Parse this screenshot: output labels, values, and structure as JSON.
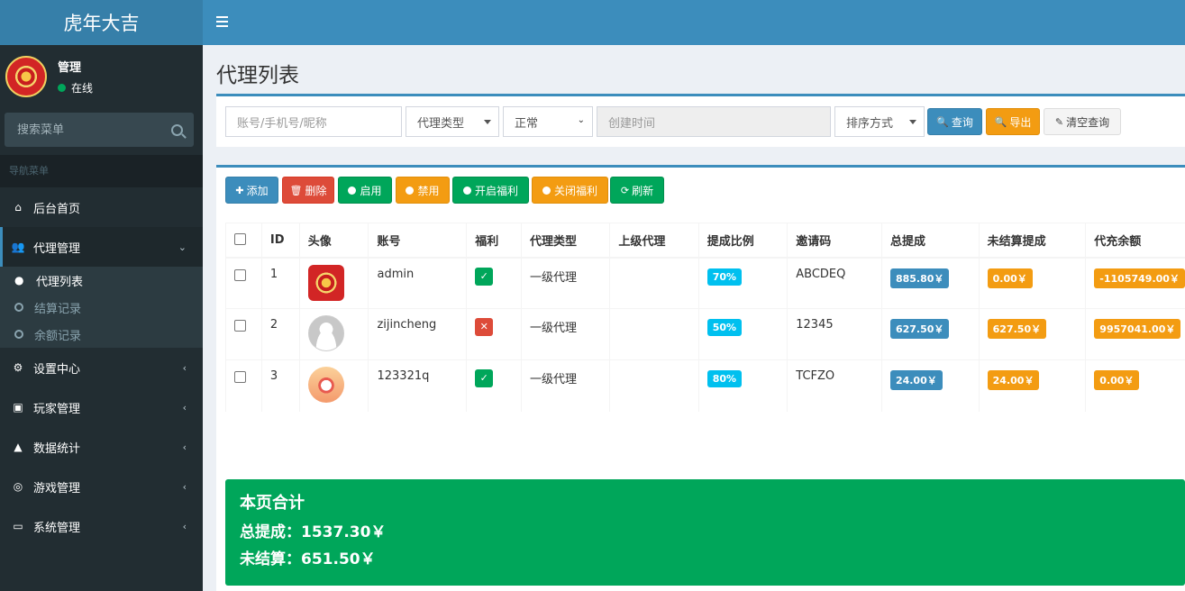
{
  "app": {
    "title": "虎年大吉"
  },
  "user": {
    "name": "管理",
    "status": "在线"
  },
  "sidebar": {
    "search_placeholder": "搜索菜单",
    "nav_header": "导航菜单",
    "items": [
      {
        "label": "后台首页",
        "icon": "home-icon"
      },
      {
        "label": "代理管理",
        "icon": "users-icon"
      },
      {
        "label": "设置中心",
        "icon": "cogs-icon"
      },
      {
        "label": "玩家管理",
        "icon": "address-book-icon"
      },
      {
        "label": "数据统计",
        "icon": "area-chart-icon"
      },
      {
        "label": "游戏管理",
        "icon": "gamepad-icon"
      },
      {
        "label": "系统管理",
        "icon": "desktop-icon"
      }
    ],
    "submenu": [
      {
        "label": "代理列表"
      },
      {
        "label": "结算记录"
      },
      {
        "label": "余额记录"
      }
    ]
  },
  "page": {
    "title": "代理列表"
  },
  "filters": {
    "account_placeholder": "账号/手机号/昵称",
    "agent_type": "代理类型",
    "status": "正常",
    "created_placeholder": "创建时间",
    "sort": "排序方式",
    "query_btn": "查询",
    "export_btn": "导出",
    "clear_btn": "清空查询"
  },
  "toolbar": {
    "add": "添加",
    "delete": "删除",
    "enable": "启用",
    "disable": "禁用",
    "welfare_on": "开启福利",
    "welfare_off": "关闭福利",
    "refresh": "刷新"
  },
  "table": {
    "headers": [
      "ID",
      "头像",
      "账号",
      "福利",
      "代理类型",
      "上级代理",
      "提成比例",
      "邀请码",
      "总提成",
      "未结算提成",
      "代充余额"
    ],
    "rows": [
      {
        "id": "1",
        "account": "admin",
        "welfare": "on",
        "type": "一级代理",
        "parent": "",
        "rate": "70%",
        "code": "ABCDEQ",
        "total": "885.80￥",
        "unsettled": "0.00￥",
        "balance": "-1105749.00￥"
      },
      {
        "id": "2",
        "account": "zijincheng",
        "welfare": "off",
        "type": "一级代理",
        "parent": "",
        "rate": "50%",
        "code": "12345",
        "total": "627.50￥",
        "unsettled": "627.50￥",
        "balance": "9957041.00￥"
      },
      {
        "id": "3",
        "account": "123321q",
        "welfare": "on",
        "type": "一级代理",
        "parent": "",
        "rate": "80%",
        "code": "TCFZO",
        "total": "24.00￥",
        "unsettled": "24.00￥",
        "balance": "0.00￥"
      }
    ]
  },
  "summary": {
    "title": "本页合计",
    "total": "总提成：1537.30￥",
    "unsettled": "未结算：651.50￥"
  },
  "colors": {
    "primary": "#3c8dbc",
    "sidebar": "#222d32",
    "success": "#00a65a",
    "warning": "#f39c12",
    "danger": "#dd4b39",
    "aqua": "#00c0ef"
  }
}
